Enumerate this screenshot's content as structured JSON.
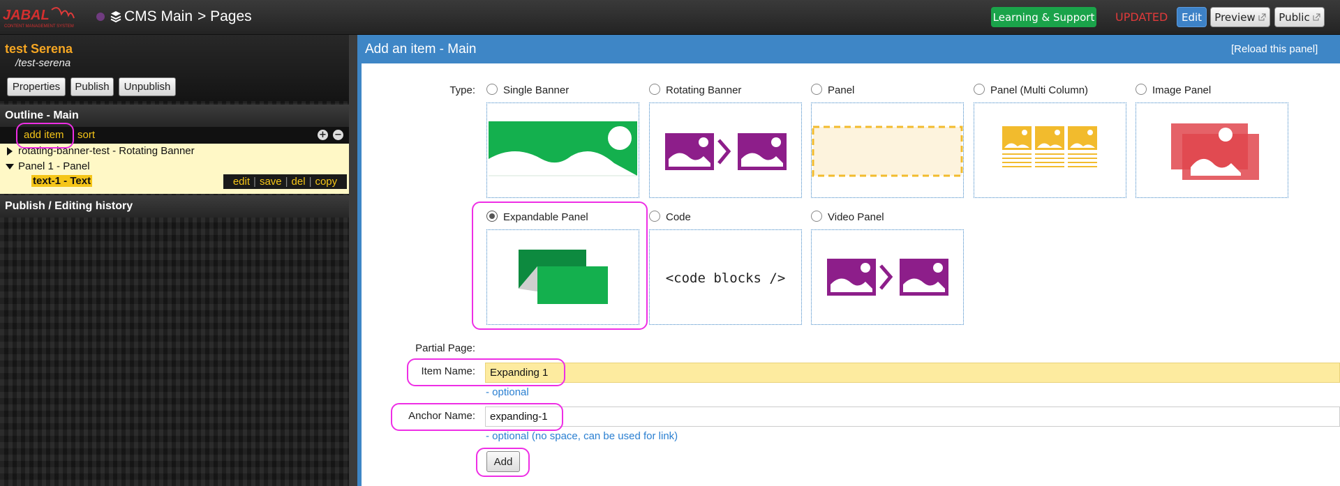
{
  "topbar": {
    "logo_text": "JABAL",
    "logo_tagline": "CONTENT MANAGEMENT SYSTEM",
    "crumb_cms": "CMS Main",
    "crumb_pages": "> Pages",
    "learning_label": "Learning & Support",
    "status": "UPDATED",
    "edit_label": "Edit",
    "preview_label": "Preview",
    "public_label": "Public",
    "colors": {
      "learn": "#1aa34a",
      "updated": "#e03a3a",
      "edit": "#3d82c7"
    }
  },
  "sidebar": {
    "page_title": "test Serena",
    "page_path": "/test-serena",
    "buttons": [
      "Properties",
      "Publish",
      "Unpublish"
    ],
    "outline_title": "Outline - Main",
    "add_item_label": "add item",
    "sort_label": "sort",
    "tree": [
      {
        "label": "rotating-banner-test - Rotating Banner",
        "expanded": false
      },
      {
        "label": "Panel 1 - Panel",
        "expanded": true
      },
      {
        "label": "text-1 - Text",
        "selected": true
      }
    ],
    "row_actions": [
      "edit",
      "save",
      "del",
      "copy"
    ],
    "history_title": "Publish / Editing history"
  },
  "panel": {
    "title": "Add an item - Main",
    "reload_label": "[Reload this panel]",
    "type_label": "Type:",
    "types": [
      {
        "label": "Single Banner",
        "icon": "single-banner-icon",
        "selected": false
      },
      {
        "label": "Rotating Banner",
        "icon": "rotating-banner-icon",
        "selected": false
      },
      {
        "label": "Panel",
        "icon": "panel-icon",
        "selected": false
      },
      {
        "label": "Panel (Multi Column)",
        "icon": "multi-column-icon",
        "selected": false
      },
      {
        "label": "Image Panel",
        "icon": "image-panel-icon",
        "selected": false
      },
      {
        "label": "Expandable Panel",
        "icon": "expandable-panel-icon",
        "selected": true
      },
      {
        "label": "Code",
        "icon": "code-icon",
        "selected": false
      },
      {
        "label": "Video Panel",
        "icon": "video-panel-icon",
        "selected": false
      }
    ],
    "code_thumb_text": "<code blocks />",
    "partial_page_label": "Partial Page:",
    "item_name_label": "Item Name:",
    "item_name_value": "Expanding 1",
    "item_name_hint": "- optional",
    "anchor_name_label": "Anchor Name:",
    "anchor_name_value": "expanding-1",
    "anchor_name_hint": "- optional (no space, can be used for link)",
    "add_button": "Add"
  }
}
